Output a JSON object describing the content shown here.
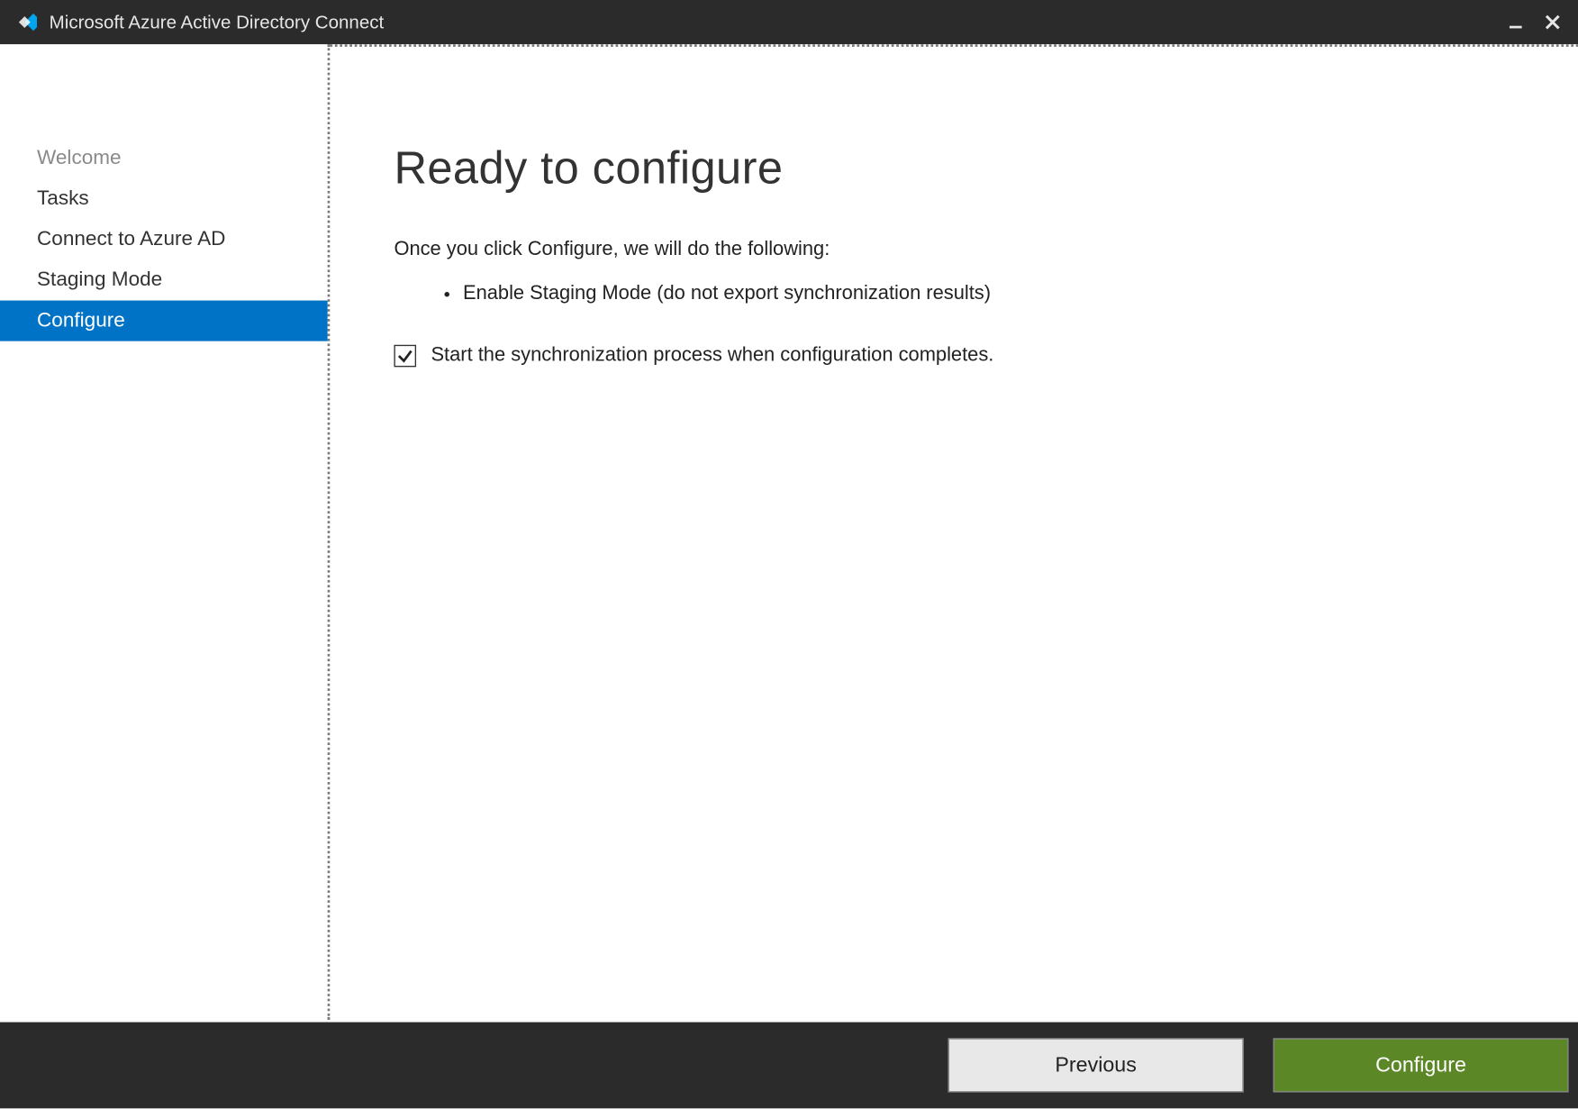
{
  "titlebar": {
    "title": "Microsoft Azure Active Directory Connect"
  },
  "sidebar": {
    "items": [
      {
        "label": "Welcome",
        "state": "muted"
      },
      {
        "label": "Tasks",
        "state": "normal"
      },
      {
        "label": "Connect to Azure AD",
        "state": "normal"
      },
      {
        "label": "Staging Mode",
        "state": "normal"
      },
      {
        "label": "Configure",
        "state": "active"
      }
    ]
  },
  "main": {
    "heading": "Ready to configure",
    "intro": "Once you click Configure, we will do the following:",
    "actions": [
      "Enable Staging Mode (do not export synchronization results)"
    ],
    "checkbox": {
      "checked": true,
      "label": "Start the synchronization process when configuration completes."
    }
  },
  "footer": {
    "previous_label": "Previous",
    "configure_label": "Configure"
  }
}
